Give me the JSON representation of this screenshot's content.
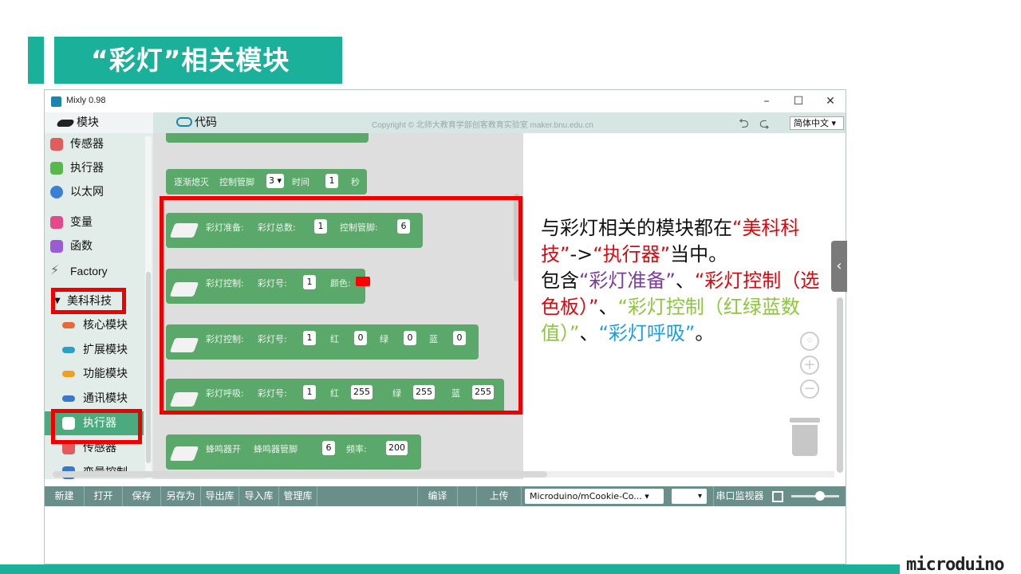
{
  "slide": {
    "title": "“彩灯”相关模块",
    "brand": "microduino"
  },
  "window": {
    "title": "Mixly 0.98",
    "minimize": "–",
    "maximize": "☐",
    "close": "✕"
  },
  "tabs": {
    "blocks": "模块",
    "code": "代码",
    "copyright": "Copyright © 北师大教育学部创客教育实验室 maker.bnu.edu.cn",
    "language": "简体中文 ▾"
  },
  "categories": [
    {
      "label": "传感器",
      "color": "#e35b5b"
    },
    {
      "label": "执行器",
      "color": "#58b84b"
    },
    {
      "label": "以太网",
      "color": "#3b7fd4"
    },
    {
      "label": "变量",
      "color": "#e44a8a"
    },
    {
      "label": "函数",
      "color": "#9b5bd4"
    },
    {
      "label": "Factory",
      "color": "#6b6b6b"
    },
    {
      "label": "美科科技",
      "color": "#333333"
    },
    {
      "label": "核心模块",
      "color": "#e86a3a"
    },
    {
      "label": "扩展模块",
      "color": "#2aa0c8"
    },
    {
      "label": "功能模块",
      "color": "#f0a020"
    },
    {
      "label": "通讯模块",
      "color": "#3a78c8"
    },
    {
      "label": "执行器",
      "color": "#58b84b"
    },
    {
      "label": "传感器",
      "color": "#e35b5b"
    },
    {
      "label": "变量控制",
      "color": "#3a78c8"
    }
  ],
  "blocks": {
    "fade": {
      "label": "逐渐熄灭",
      "pin_label": "控制管脚",
      "pin": "3 ▾",
      "time_label": "时间",
      "time": "1",
      "unit": "秒"
    },
    "setup": {
      "label": "彩灯准备:",
      "count_label": "彩灯总数:",
      "count": "1",
      "pin_label": "控制管脚:",
      "pin": "6"
    },
    "ctrl_color": {
      "label": "彩灯控制:",
      "num_label": "彩灯号:",
      "num": "1",
      "color_label": "颜色:",
      "color": "#ff0000"
    },
    "ctrl_rgb": {
      "label": "彩灯控制:",
      "num_label": "彩灯号:",
      "num": "1",
      "r_label": "红",
      "r": "0",
      "g_label": "绿",
      "g": "0",
      "b_label": "蓝",
      "b": "0"
    },
    "breath": {
      "label": "彩灯呼吸:",
      "num_label": "彩灯号:",
      "num": "1",
      "r_label": "红",
      "r": "255",
      "g_label": "绿",
      "g": "255",
      "b_label": "蓝",
      "b": "255"
    },
    "buzzer": {
      "label": "蜂鸣器开",
      "pin_label": "蜂鸣器管脚",
      "pin": "6",
      "freq_label": "频率:",
      "freq": "200"
    }
  },
  "toolbar": {
    "new": "新建",
    "open": "打开",
    "save": "保存",
    "save_as": "另存为",
    "export_lib": "导出库",
    "import_lib": "导入库",
    "manage_lib": "管理库",
    "compile": "编译",
    "upload": "上传",
    "board": "Microduino/mCookie-Co...  ▾",
    "port": "▾",
    "serial_monitor": "串口监视器"
  },
  "note": {
    "p1": "与彩灯相关的模块都在",
    "q1": "“美科科技”",
    "arrow": "->",
    "q2": "“执行器”",
    "p2": "当中。",
    "p3": "包含",
    "i1": "“彩灯准备”",
    "sep1": "、",
    "i2": "“彩灯控制（选色板）”",
    "sep2": "、",
    "i3": "“彩灯控制（红绿蓝数值）”",
    "sep3": "、",
    "i4": "“彩灯呼吸”",
    "end": "。"
  }
}
